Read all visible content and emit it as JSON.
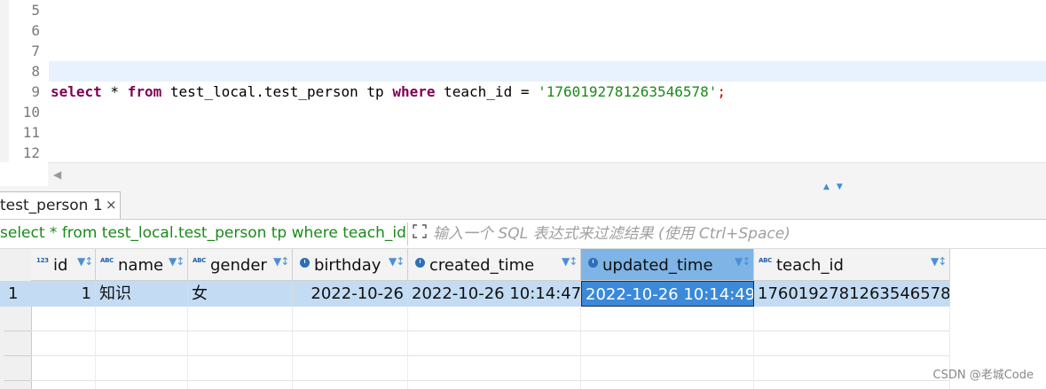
{
  "editor": {
    "line_numbers": [
      "5",
      "6",
      "7",
      "8",
      "9",
      "10",
      "11",
      "12"
    ],
    "sql": {
      "kw_select": "select",
      "star": " * ",
      "kw_from": "from",
      "table": " test_local.test_person tp ",
      "kw_where": "where",
      "condition": " teach_id = ",
      "literal": "'1760192781263546578'",
      "semicolon": ";"
    }
  },
  "results_tab": {
    "label": "test_person 1",
    "close": "×"
  },
  "filter": {
    "query_preview": "select * from test_local.test_person tp where teach_id",
    "placeholder": "输入一个 SQL 表达式来过滤结果 (使用 Ctrl+Space)"
  },
  "grid": {
    "columns": [
      {
        "name": "id",
        "type_icon": "123-icon"
      },
      {
        "name": "name",
        "type_icon": "abc-icon"
      },
      {
        "name": "gender",
        "type_icon": "abc-icon"
      },
      {
        "name": "birthday",
        "type_icon": "clock-icon"
      },
      {
        "name": "created_time",
        "type_icon": "clock-icon"
      },
      {
        "name": "updated_time",
        "type_icon": "clock-icon"
      },
      {
        "name": "teach_id",
        "type_icon": "abc-icon"
      }
    ],
    "rows": [
      {
        "row_number": "1",
        "id": "1",
        "name": "知识",
        "gender": "女",
        "birthday": "2022-10-26",
        "created_time": "2022-10-26 10:14:47",
        "updated_time": "2022-10-26 10:14:49",
        "teach_id": "1760192781263546578"
      }
    ],
    "type_icon_text": {
      "num": "123",
      "abc": "ABC"
    }
  },
  "watermark": "CSDN @老城Code",
  "colors": {
    "keyword": "#7f0055",
    "string": "#1a8a1a",
    "query_text": "#1b8a1b",
    "selected_cell": "#3b89d8",
    "selected_row": "#c3dcf3"
  }
}
